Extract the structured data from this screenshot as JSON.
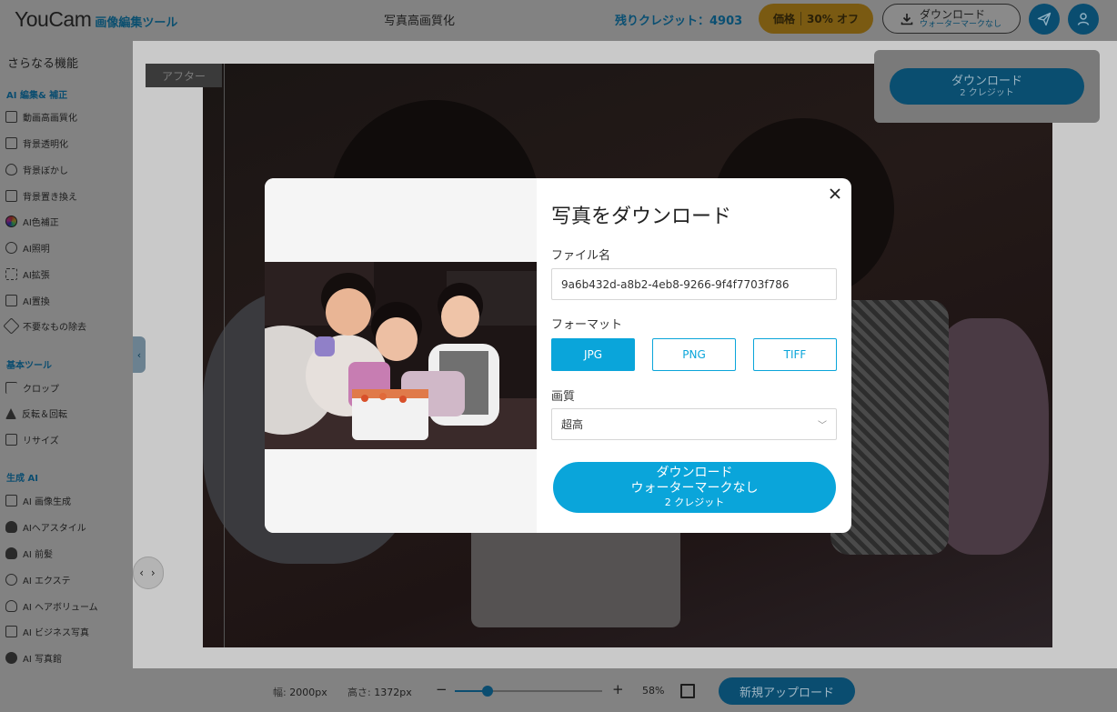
{
  "header": {
    "logo_main": "YouCam",
    "logo_sub": "画像編集ツール",
    "page_title": "写真高画質化",
    "credits_text": "残りクレジット：4903",
    "price_label": "価格",
    "price_discount": "30% オフ",
    "download_label": "ダウンロード",
    "download_sub": "ウォーターマークなし",
    "share_icon": "paper-plane-icon",
    "account_icon": "user-icon"
  },
  "sidebar": {
    "title": "さらなる機能",
    "sections": [
      {
        "title": "AI 編集& 補正",
        "items": [
          "動画高画質化",
          "背景透明化",
          "背景ぼかし",
          "背景置き換え",
          "AI色補正",
          "AI照明",
          "AI拡張",
          "AI置換",
          "不要なもの除去"
        ]
      },
      {
        "title": "基本ツール",
        "items": [
          "クロップ",
          "反転＆回転",
          "リサイズ"
        ]
      },
      {
        "title": "生成 AI",
        "items": [
          "AI 画像生成",
          "AIヘアスタイル",
          "AI 前髪",
          "AI エクステ",
          "AI ヘアボリューム",
          "AI ビジネス写真",
          "AI 写真館"
        ]
      }
    ]
  },
  "canvas": {
    "after_label": "アフター",
    "panel_download": "ダウンロード",
    "panel_credits": "2 クレジット"
  },
  "modal": {
    "title": "写真をダウンロード",
    "filename_label": "ファイル名",
    "filename_value": "9a6b432d-a8b2-4eb8-9266-9f4f7703f786",
    "format_label": "フォーマット",
    "formats": [
      "JPG",
      "PNG",
      "TIFF"
    ],
    "selected_format": "JPG",
    "quality_label": "画質",
    "quality_value": "超高",
    "download_line1": "ダウンロード",
    "download_line2": "ウォーターマークなし",
    "download_line3": "2 クレジット",
    "close_icon": "close-icon"
  },
  "bottom_bar": {
    "width_label": "幅:",
    "width_value": "2000px",
    "height_label": "高さ:",
    "height_value": "1372px",
    "zoom_minus": "−",
    "zoom_plus": "+",
    "zoom_value": "58%",
    "zoom_fraction": 0.22,
    "upload_label": "新規アップロード"
  },
  "colors": {
    "accent": "#0aa5da",
    "price": "#f0a800"
  }
}
